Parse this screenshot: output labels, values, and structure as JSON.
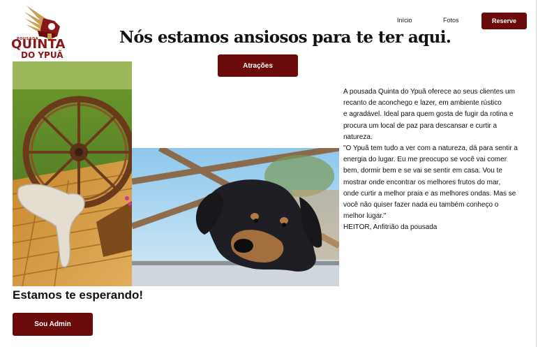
{
  "logo": {
    "small": "POUSADA",
    "name_line1": "QUINTA",
    "name_line2": "DO YPUÃ"
  },
  "nav": {
    "inicio": "Início",
    "fotos": "Fotos",
    "reserve": "Reserve"
  },
  "hero": {
    "headline": "Nós estamos ansiosos para te ter aqui.",
    "attractions_button": "Atrações"
  },
  "description": {
    "lines": [
      "A pousada Quinta do Ypuã oferece ao seus clientes um",
      "recanto de aconchego e lazer, em ambiente  rústico",
      "e agradável.  Ideal para quem gosta de fugir da rotina e",
      "procura um local de paz para descansar e curtir a",
      "natureza.",
      "\"O Ypuã tem tudo a ver com a natureza, dá para sentir a",
      "energia do lugar. Eu me preocupo se você vai comer",
      "bem, dormir bem e se vai se sentir em casa. Vou te",
      "mostrar onde encontrar os melhores frutos do mar,",
      "onde curtir a melhor praia e as melhores ondas. Mas se",
      "você não quiser fazer nada eu também conheço o",
      "melhor lugar.\"",
      "HEITOR, Anfitrião da pousada"
    ]
  },
  "footer": {
    "waiting": "Estamos te esperando!",
    "admin_button": "Sou Admin"
  },
  "colors": {
    "brand": "#6a0a0a",
    "logo_red": "#8a1717",
    "logo_gold": "#c9a258"
  },
  "images": {
    "wheel_photo": "wagon-wheel-on-wooden-deck",
    "dog_photo": "dog-resting-head"
  }
}
